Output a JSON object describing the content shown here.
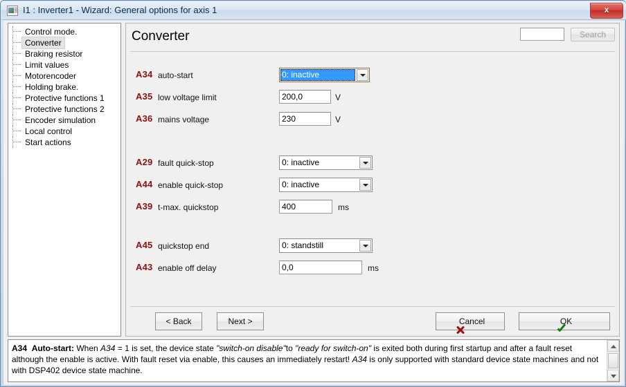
{
  "window": {
    "title": "I1 : Inverter1 - Wizard: General options for axis 1",
    "icon": "window-document-icon",
    "close_label": "x"
  },
  "sidebar": {
    "items": [
      {
        "label": "Control mode.",
        "selected": false
      },
      {
        "label": "Converter",
        "selected": true
      },
      {
        "label": "Braking resistor",
        "selected": false
      },
      {
        "label": "Limit values",
        "selected": false
      },
      {
        "label": "Motorencoder",
        "selected": false
      },
      {
        "label": "Holding brake.",
        "selected": false
      },
      {
        "label": "Protective functions 1",
        "selected": false
      },
      {
        "label": "Protective functions 2",
        "selected": false
      },
      {
        "label": "Encoder simulation",
        "selected": false
      },
      {
        "label": "Local control",
        "selected": false
      },
      {
        "label": "Start actions",
        "selected": false
      }
    ]
  },
  "main": {
    "page_title": "Converter",
    "search": {
      "value": "",
      "placeholder": "",
      "button_label": "Search",
      "button_enabled": false
    },
    "params": [
      {
        "code": "A34",
        "label": "auto-start",
        "control": "combo",
        "value": "0: inactive",
        "unit": "",
        "focused": true
      },
      {
        "code": "A35",
        "label": "low voltage limit",
        "control": "text",
        "value": "200,0",
        "unit": "V",
        "focused": false
      },
      {
        "code": "A36",
        "label": "mains voltage",
        "control": "text",
        "value": "230",
        "unit": "V",
        "focused": false
      },
      {
        "code": "A29",
        "label": "fault quick-stop",
        "control": "combo",
        "value": "0: inactive",
        "unit": "",
        "focused": false
      },
      {
        "code": "A44",
        "label": "enable quick-stop",
        "control": "combo",
        "value": "0: inactive",
        "unit": "",
        "focused": false
      },
      {
        "code": "A39",
        "label": "t-max. quickstop",
        "control": "text",
        "value": "400",
        "unit": "ms",
        "focused": false
      },
      {
        "code": "A45",
        "label": "quickstop end",
        "control": "combo",
        "value": "0: standstill",
        "unit": "",
        "focused": false
      },
      {
        "code": "A43",
        "label": "enable off delay",
        "control": "text",
        "value": "0,0",
        "unit": "ms",
        "focused": false
      }
    ],
    "buttons": {
      "back": "< Back",
      "next": "Next >",
      "cancel": "Cancel",
      "ok": "OK"
    }
  },
  "help": {
    "code": "A34",
    "title": "Auto-start:",
    "body_1": "When ",
    "em_1": "A34",
    "body_2": " = 1 is set, the device state ",
    "q_1": "\"switch-on disable\"",
    "body_3": "to ",
    "q_2": "\"ready for switch-on\"",
    "body_4": " is exited both during first startup and after a fault reset although the enable is active. With fault reset via enable, this causes an immediately restart! ",
    "em_2": "A34",
    "body_5": " is only supported with standard device state machines and not with DSP402 device state machine."
  },
  "colors": {
    "param_code": "#8b1010",
    "selection_blue": "#3399ff",
    "cancel_icon": "#9b0f12",
    "ok_icon": "#0f7b16",
    "window_bg": "#f0f0f0"
  }
}
